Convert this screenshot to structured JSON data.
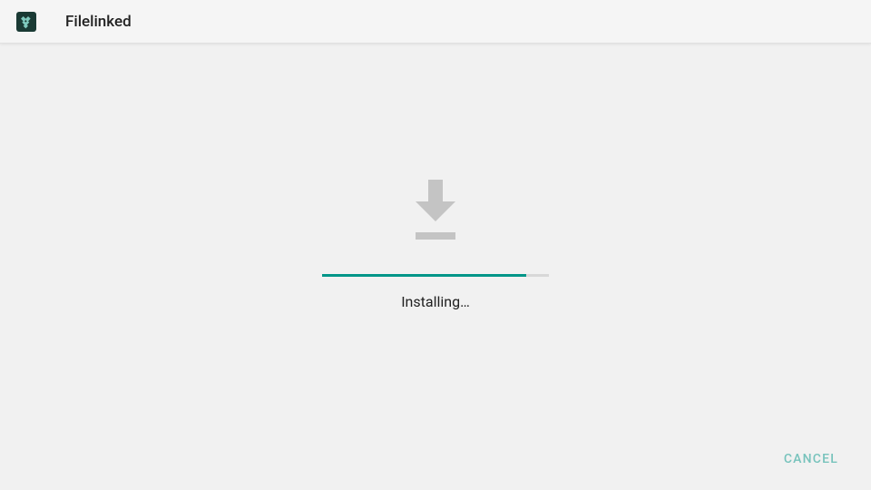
{
  "header": {
    "app_title": "Filelinked"
  },
  "main": {
    "status_text": "Installing…",
    "progress_percent": 90
  },
  "actions": {
    "cancel_label": "CANCEL"
  },
  "icons": {
    "app_icon": "filelinked-icon",
    "download_icon": "download-icon"
  },
  "colors": {
    "accent": "#009688",
    "icon_grey": "#c4c4c4",
    "background": "#f1f1f1"
  }
}
